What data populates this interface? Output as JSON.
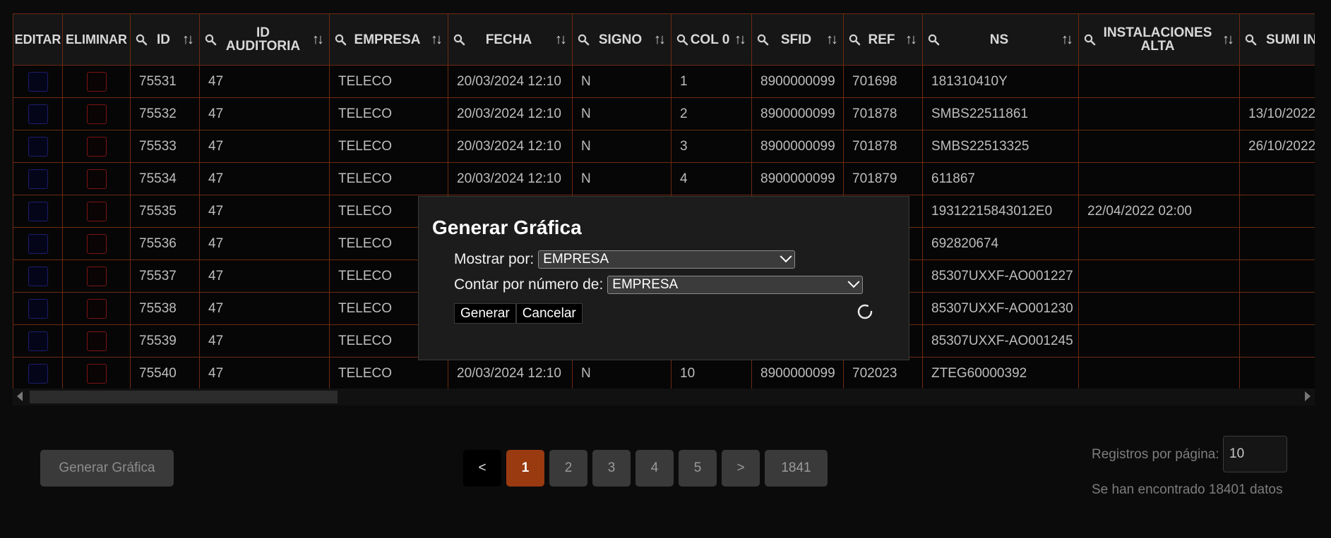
{
  "table": {
    "columns": [
      {
        "key": "editar",
        "label": "EDITAR",
        "search": false,
        "sort": false
      },
      {
        "key": "eliminar",
        "label": "ELIMINAR",
        "search": false,
        "sort": false
      },
      {
        "key": "id",
        "label": "ID",
        "search": true,
        "sort": true
      },
      {
        "key": "id_auditoria",
        "label": "ID AUDITORIA",
        "search": true,
        "sort": true
      },
      {
        "key": "empresa",
        "label": "EMPRESA",
        "search": true,
        "sort": true
      },
      {
        "key": "fecha",
        "label": "FECHA",
        "search": true,
        "sort": true
      },
      {
        "key": "signo",
        "label": "SIGNO",
        "search": true,
        "sort": true
      },
      {
        "key": "col0",
        "label": "COL 0",
        "search": true,
        "sort": true
      },
      {
        "key": "sfid",
        "label": "SFID",
        "search": true,
        "sort": true
      },
      {
        "key": "ref",
        "label": "REF",
        "search": true,
        "sort": true
      },
      {
        "key": "ns",
        "label": "NS",
        "search": true,
        "sort": true
      },
      {
        "key": "instalaciones_alta",
        "label": "INSTALACIONES ALTA",
        "search": true,
        "sort": true
      },
      {
        "key": "suministro_instalacion",
        "label": "SUMI INSTAL",
        "search": true,
        "sort": false
      }
    ],
    "rows": [
      [
        "75531",
        "47",
        "TELECO",
        "20/03/2024 12:10",
        "N",
        "1",
        "8900000099",
        "701698",
        "181310410Y",
        "",
        ""
      ],
      [
        "75532",
        "47",
        "TELECO",
        "20/03/2024 12:10",
        "N",
        "2",
        "8900000099",
        "701878",
        "SMBS22511861",
        "",
        "13/10/2022"
      ],
      [
        "75533",
        "47",
        "TELECO",
        "20/03/2024 12:10",
        "N",
        "3",
        "8900000099",
        "701878",
        "SMBS22513325",
        "",
        "26/10/2022"
      ],
      [
        "75534",
        "47",
        "TELECO",
        "20/03/2024 12:10",
        "N",
        "4",
        "8900000099",
        "701879",
        "611867",
        "",
        ""
      ],
      [
        "75535",
        "47",
        "TELECO",
        "",
        "",
        "",
        "",
        "",
        "19312215843012E0",
        "22/04/2022 02:00",
        ""
      ],
      [
        "75536",
        "47",
        "TELECO",
        "",
        "",
        "",
        "",
        "",
        "692820674",
        "",
        ""
      ],
      [
        "75537",
        "47",
        "TELECO",
        "",
        "",
        "",
        "",
        "",
        "85307UXXF-AO001227",
        "",
        ""
      ],
      [
        "75538",
        "47",
        "TELECO",
        "",
        "",
        "",
        "",
        "",
        "85307UXXF-AO001230",
        "",
        ""
      ],
      [
        "75539",
        "47",
        "TELECO",
        "",
        "",
        "",
        "",
        "",
        "85307UXXF-AO001245",
        "",
        ""
      ],
      [
        "75540",
        "47",
        "TELECO",
        "20/03/2024 12:10",
        "N",
        "10",
        "8900000099",
        "702023",
        "ZTEG60000392",
        "",
        ""
      ]
    ]
  },
  "footer": {
    "chart_button": "Generar Gráfica",
    "pager": {
      "prev": "<",
      "pages": [
        "1",
        "2",
        "3",
        "4",
        "5"
      ],
      "active": "1",
      "next": ">",
      "last": "1841"
    },
    "records_label": "Registros por página:",
    "records_value": "10",
    "found_text": "Se han encontrado 18401 datos"
  },
  "modal": {
    "title": "Generar Gráfica",
    "show_by_label": "Mostrar por:",
    "show_by_value": "EMPRESA",
    "count_by_label": "Contar por número de:",
    "count_by_value": "EMPRESA",
    "generate_button": "Generar",
    "cancel_button": "Cancelar"
  },
  "colors": {
    "accent": "#9a3a10",
    "border": "#6e2a10",
    "background": "#0b0b0b"
  }
}
